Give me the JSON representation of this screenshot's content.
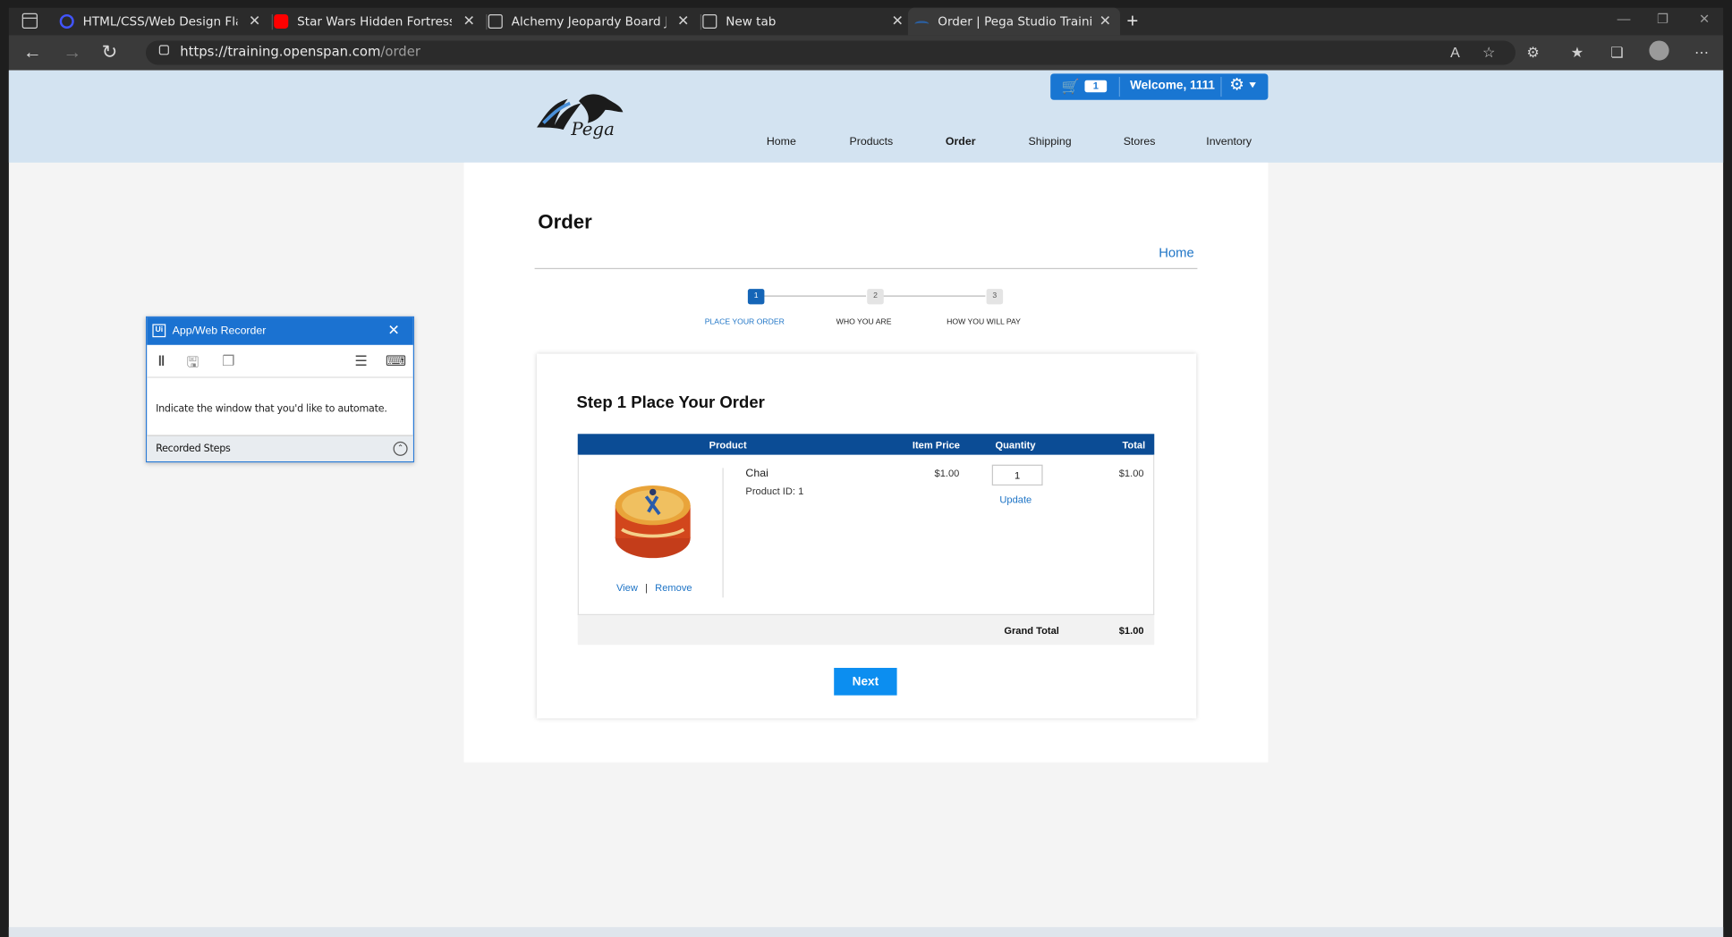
{
  "browser": {
    "tabs": [
      {
        "title": "HTML/CSS/Web Design Flashcar",
        "favicon": "quizlet-icon",
        "color": "#4255ff"
      },
      {
        "title": "Star Wars Hidden Fortress Comp",
        "favicon": "youtube-icon",
        "color": "#ff0000"
      },
      {
        "title": "Alchemy Jeopardy Board Jeopar",
        "favicon": "jeopardy-icon",
        "color": "#888888"
      },
      {
        "title": "New tab",
        "favicon": "newtab-icon",
        "color": "#888888"
      },
      {
        "title": "Order | Pega Studio Training Wel",
        "favicon": "pega-icon",
        "color": "#1b2b4b",
        "active": true
      }
    ],
    "url_host": "https://training.openspan.com",
    "url_path": "/order"
  },
  "site": {
    "logo_text": "Pega",
    "nav": [
      "Home",
      "Products",
      "Order",
      "Shipping",
      "Stores",
      "Inventory"
    ],
    "active_nav": "Order",
    "cart_count": "1",
    "welcome": "Welcome, 1111"
  },
  "order": {
    "heading": "Order",
    "home_link": "Home",
    "steps": [
      {
        "num": "1",
        "label": "PLACE YOUR ORDER",
        "active": true
      },
      {
        "num": "2",
        "label": "WHO YOU ARE",
        "active": false
      },
      {
        "num": "3",
        "label": "HOW YOU WILL PAY",
        "active": false
      }
    ],
    "step_heading": "Step 1 Place Your Order",
    "columns": {
      "product": "Product",
      "item_price": "Item Price",
      "quantity": "Quantity",
      "total": "Total"
    },
    "item": {
      "name": "Chai",
      "product_id": "Product ID: 1",
      "price": "$1.00",
      "quantity": "1",
      "total": "$1.00",
      "view": "View",
      "separator": "|",
      "remove": "Remove",
      "update": "Update"
    },
    "grand_total_label": "Grand Total",
    "grand_total": "$1.00",
    "next": "Next"
  },
  "recorder": {
    "title": "App/Web Recorder",
    "message": "Indicate the window that you'd like to automate.",
    "recorded_steps": "Recorded Steps"
  },
  "colors": {
    "accent": "#1976d2",
    "header_bg": "#d3e3f1",
    "table_header": "#0b4c95",
    "next_button": "#0c8ef0"
  }
}
